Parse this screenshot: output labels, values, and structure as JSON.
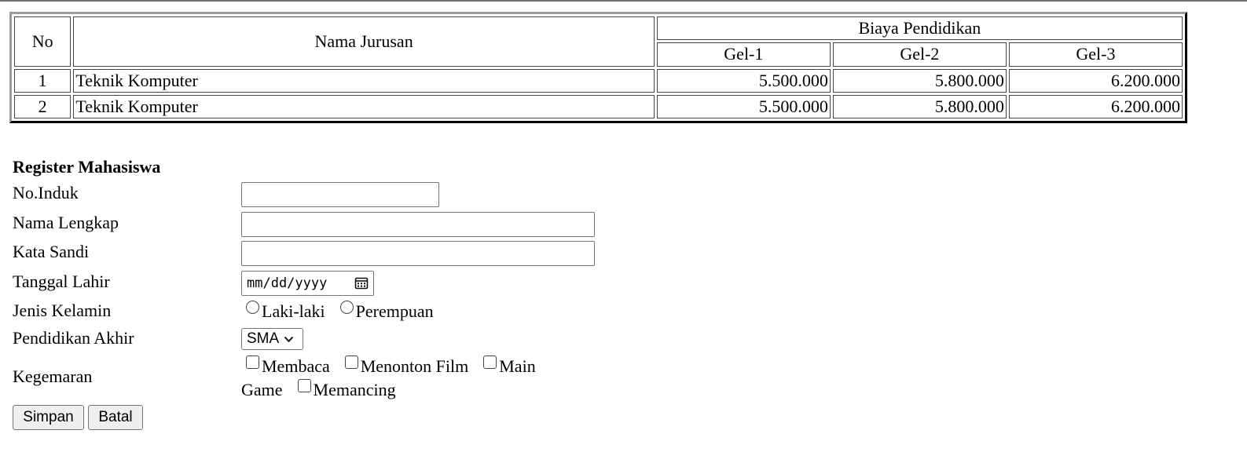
{
  "fee_table": {
    "header_no": "No",
    "header_name": "Nama Jurusan",
    "header_group": "Biaya Pendidikan",
    "header_gel": [
      "Gel-1",
      "Gel-2",
      "Gel-3"
    ],
    "rows": [
      {
        "no": "1",
        "name": "Teknik Komputer",
        "gel1": "5.500.000",
        "gel2": "5.800.000",
        "gel3": "6.200.000"
      },
      {
        "no": "2",
        "name": "Teknik Komputer",
        "gel1": "5.500.000",
        "gel2": "5.800.000",
        "gel3": "6.200.000"
      }
    ]
  },
  "form": {
    "title": "Register Mahasiswa",
    "labels": {
      "no_induk": "No.Induk",
      "nama_lengkap": "Nama Lengkap",
      "kata_sandi": "Kata Sandi",
      "tanggal_lahir": "Tanggal Lahir",
      "jenis_kelamin": "Jenis Kelamin",
      "pendidikan_akhir": "Pendidikan Akhir",
      "kegemaran": "Kegemaran"
    },
    "values": {
      "no_induk": "",
      "nama_lengkap": "",
      "kata_sandi": ""
    },
    "date_placeholder": "mm/dd/yyyy",
    "gender_options": [
      "Laki-laki",
      "Perempuan"
    ],
    "education_selected": "SMA",
    "hobbies": [
      "Membaca",
      "Menonton Film",
      "Main",
      "Game",
      "Memancing"
    ],
    "buttons": {
      "save": "Simpan",
      "cancel": "Batal"
    }
  }
}
